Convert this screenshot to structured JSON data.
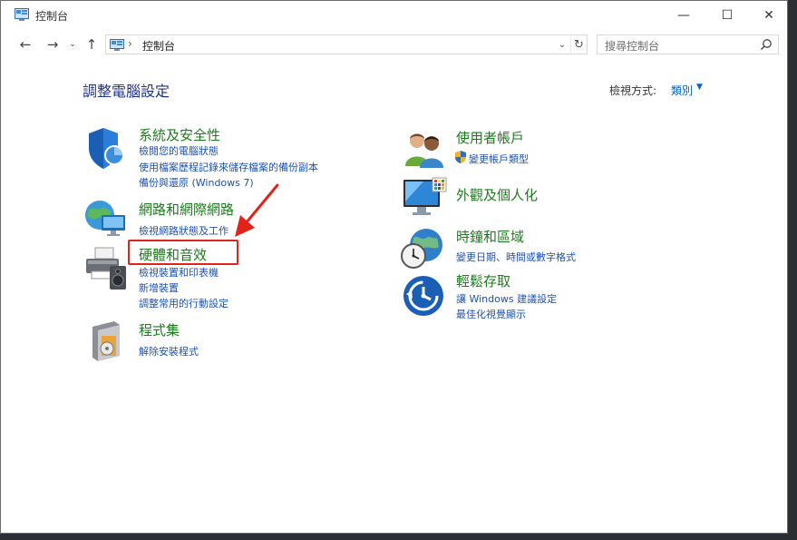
{
  "window": {
    "title": "控制台",
    "buttons": {
      "minimize": "—",
      "maximize": "☐",
      "close": "✕"
    }
  },
  "nav": {
    "back": "←",
    "forward": "→",
    "recent": "⌄",
    "up": "↑",
    "address_sep": "›",
    "address": "控制台",
    "address_dropdown": "⌄",
    "refresh": "↻",
    "search_placeholder": "搜尋控制台"
  },
  "content": {
    "heading": "調整電腦設定",
    "view_by_label": "檢視方式:",
    "view_by_value": "類別",
    "view_by_arrow": "▼"
  },
  "categories": [
    {
      "icon": "shield-icon",
      "title": "系統及安全性",
      "links": [
        "檢閱您的電腦狀態",
        "使用檔案歷程記錄來儲存檔案的備份副本",
        "備份與還原 (Windows 7)"
      ]
    },
    {
      "icon": "network-icon",
      "title": "網路和網際網路",
      "links": [
        "檢視網路狀態及工作"
      ]
    },
    {
      "icon": "printer-icon",
      "title": "硬體和音效",
      "links": [
        "檢視裝置和印表機",
        "新增裝置",
        "調整常用的行動設定"
      ]
    },
    {
      "icon": "programs-icon",
      "title": "程式集",
      "links": [
        "解除安裝程式"
      ]
    },
    {
      "icon": "users-icon",
      "title": "使用者帳戶",
      "links": [
        "變更帳戶類型"
      ]
    },
    {
      "icon": "monitor-icon",
      "title": "外觀及個人化",
      "links": []
    },
    {
      "icon": "globe-clock-icon",
      "title": "時鐘和區域",
      "links": [
        "變更日期、時間或數字格式"
      ]
    },
    {
      "icon": "ease-of-access-icon",
      "title": "輕鬆存取",
      "links": [
        "讓 Windows 建議設定",
        "最佳化視覺顯示"
      ]
    }
  ],
  "colors": {
    "heading": "#1e3287",
    "category_title": "#1e7a1e",
    "link": "#1d52b5",
    "highlight": "#e2231a"
  }
}
